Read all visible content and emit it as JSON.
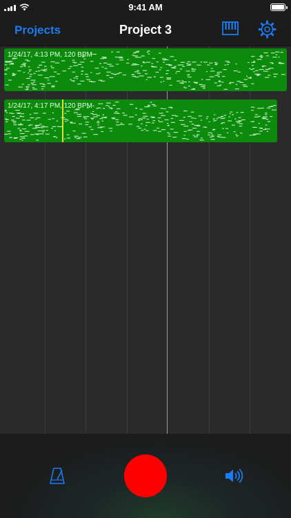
{
  "status_bar": {
    "time": "9:41 AM"
  },
  "nav": {
    "back_label": "Projects",
    "title": "Project 3",
    "accent_color": "#1a7cf5"
  },
  "icons": {
    "piano": "piano-keyboard-icon",
    "settings": "gear-icon",
    "metronome": "metronome-icon",
    "volume": "speaker-volume-icon"
  },
  "tracks": [
    {
      "label": "1/24/17, 4:13 PM, 120 BPM",
      "color": "#0b8a0b"
    },
    {
      "label": "1/24/17, 4:17 PM, 120 BPM",
      "color": "#0b8a0b"
    }
  ],
  "record_color": "#ff0000"
}
